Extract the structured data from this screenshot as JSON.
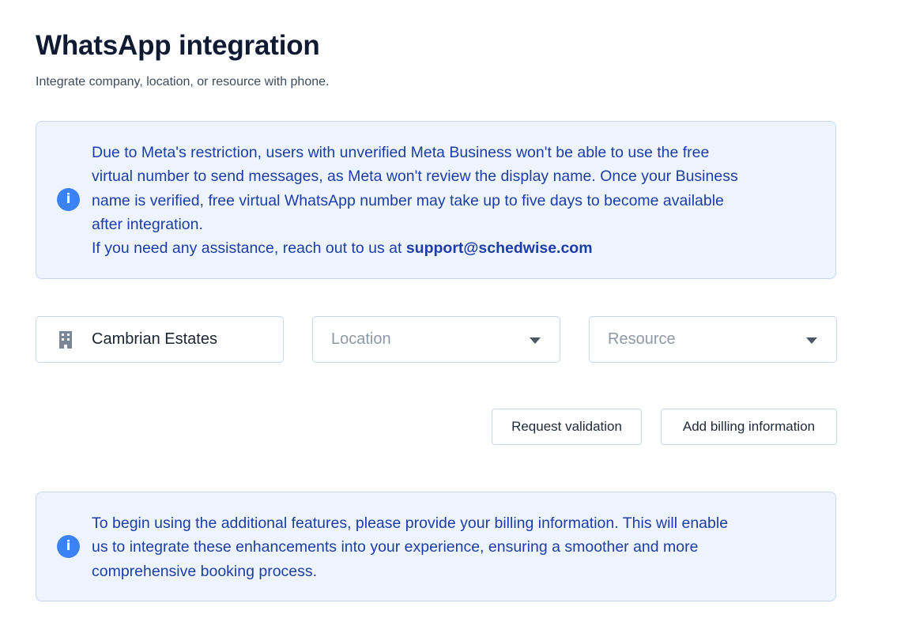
{
  "header": {
    "title": "WhatsApp integration",
    "subtitle": "Integrate company, location, or resource with phone."
  },
  "meta_notice": {
    "icon": "info-icon",
    "icon_glyph": "i",
    "line1": "Due to Meta's restriction, users with unverified Meta Business won't be able to use the free",
    "line2": "virtual number to send messages, as Meta won't review the display name. Once your Business",
    "line3": "name is verified, free virtual WhatsApp number may take up to five days to become available",
    "line4": "after integration.",
    "assistance_text": "If you need any assistance, reach out to us at ",
    "support_email": "support@schedwise.com"
  },
  "filters": {
    "company": {
      "icon": "building-icon",
      "value": "Cambrian Estates"
    },
    "location": {
      "placeholder": "Location",
      "icon": "caret-down-icon"
    },
    "resource": {
      "placeholder": "Resource",
      "icon": "caret-down-icon"
    }
  },
  "actions": {
    "request_validation": "Request validation",
    "add_billing": "Add billing information"
  },
  "billing_notice": {
    "icon": "info-icon",
    "icon_glyph": "i",
    "line1": "To begin using the additional features, please provide your billing information. This will enable",
    "line2": "us to integrate these enhancements into your experience, ensuring a smoother and more",
    "line3": "comprehensive booking process."
  },
  "colors": {
    "notice_background": "#eef4fd",
    "notice_border": "#c4d8f5",
    "notice_text": "#1d3da8",
    "info_icon": "#3b82f6",
    "field_border": "#c6d6ec"
  }
}
